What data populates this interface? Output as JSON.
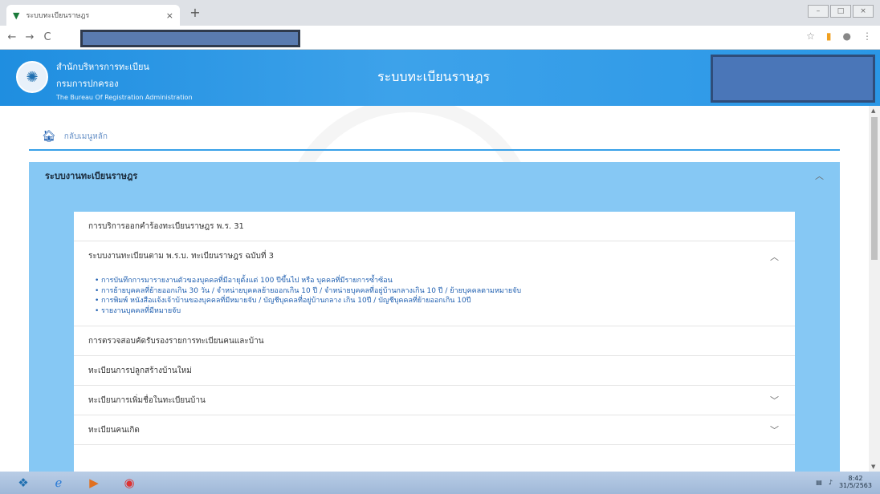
{
  "browser": {
    "tab_title": "ระบบทะเบียนราษฎร",
    "tab_close": "×",
    "new_tab": "+",
    "nav": {
      "back": "←",
      "forward": "→",
      "reload": "C"
    },
    "window_controls": [
      "–",
      "□",
      "×"
    ]
  },
  "header": {
    "org_line1": "สำนักบริหารการทะเบียน",
    "org_line2": "กรมการปกครอง",
    "org_line3": "The Bureau Of Registration Administration",
    "site_title": "ระบบทะเบียนราษฎร"
  },
  "breadcrumb": {
    "home_label": "กลับเมนูหลัก"
  },
  "panel": {
    "title": "ระบบงานทะเบียนราษฎร",
    "rows": [
      {
        "label": "การบริการออกคำร้องทะเบียนราษฎร พ.ร. 31"
      },
      {
        "label": "ระบบงานทะเบียนตาม พ.ร.บ. ทะเบียนราษฎร ฉบับที่ 3"
      },
      {
        "label": "การตรวจสอบคัดรับรองรายการทะเบียนคนและบ้าน"
      },
      {
        "label": "ทะเบียนการปลูกสร้างบ้านใหม่"
      },
      {
        "label": "ทะเบียนการเพิ่มชื่อในทะเบียนบ้าน"
      },
      {
        "label": "ทะเบียนคนเกิด"
      }
    ],
    "links": [
      "การบันทึกการมารายงานตัวของบุคคลที่มีอายุตั้งแต่ 100 ปีขึ้นไป หรือ บุคคลที่มีรายการซ้ำซ้อน",
      "การย้ายบุคคลที่ย้ายออกเกิน 30 วัน / จำหน่ายบุคคลย้ายออกเกิน 10 ปี / จำหน่ายบุคคลที่อยู่บ้านกลางเกิน 10 ปี / ย้ายบุคคลตามหมายจับ",
      "การพิมพ์ หนังสือแจ้งเจ้าบ้านของบุคคลที่มีหมายจับ / บัญชีบุคคลที่อยู่บ้านกลาง เกิน 10ปี / บัญชีบุคคลที่ย้ายออกเกิน 10ปี",
      "รายงานบุคคลที่มีหมายจับ"
    ]
  },
  "taskbar": {
    "clock_time": "8:42",
    "clock_date": "31/5/2563"
  }
}
